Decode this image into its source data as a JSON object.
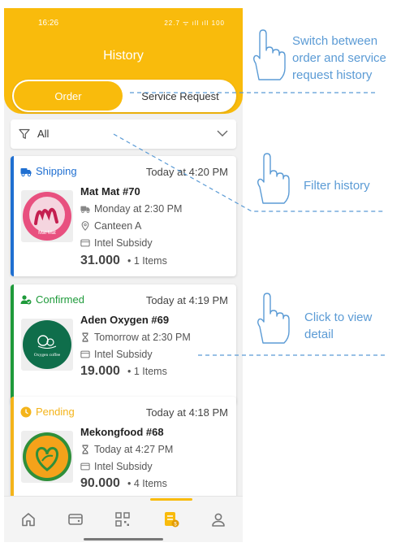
{
  "status_bar": {
    "time": "16:26",
    "icons": "22.7 ᯤ ıll ıll 100"
  },
  "header": {
    "title": "History"
  },
  "tabs": {
    "order": "Order",
    "service": "Service Request"
  },
  "filter": {
    "label": "All"
  },
  "orders": [
    {
      "status": "Shipping",
      "status_color": "#1f6fd1",
      "time": "Today at 4:20 PM",
      "name": "Mat Mat #70",
      "schedule": "Monday at 2:30 PM",
      "location": "Canteen A",
      "payment": "Intel Subsidy",
      "price": "31.000",
      "items": "1 Items",
      "logo_text": "Mat Mat"
    },
    {
      "status": "Confirmed",
      "status_color": "#1e9a3a",
      "time": "Today at 4:19 PM",
      "name": "Aden Oxygen #69",
      "schedule": "Tomorrow at 2:30 PM",
      "payment": "Intel Subsidy",
      "price": "19.000",
      "items": "1 Items",
      "logo_text": "Oxygen coffee"
    },
    {
      "status": "Pending",
      "status_color": "#f4b41a",
      "time": "Today at 4:18 PM",
      "name": "Mekongfood #68",
      "schedule": "Today at 4:27 PM",
      "payment": "Intel Subsidy",
      "price": "90.000",
      "items": "4 Items"
    }
  ],
  "nav": [
    "home-icon",
    "wallet-icon",
    "qr-code-icon",
    "orders-icon",
    "profile-icon"
  ],
  "annotations": {
    "switch": "Switch between order and service request history",
    "filter": "Filter history",
    "detail": "Click to view detail"
  },
  "colors": {
    "accent": "#f9bb0c",
    "annotation": "#5b9bd5"
  }
}
